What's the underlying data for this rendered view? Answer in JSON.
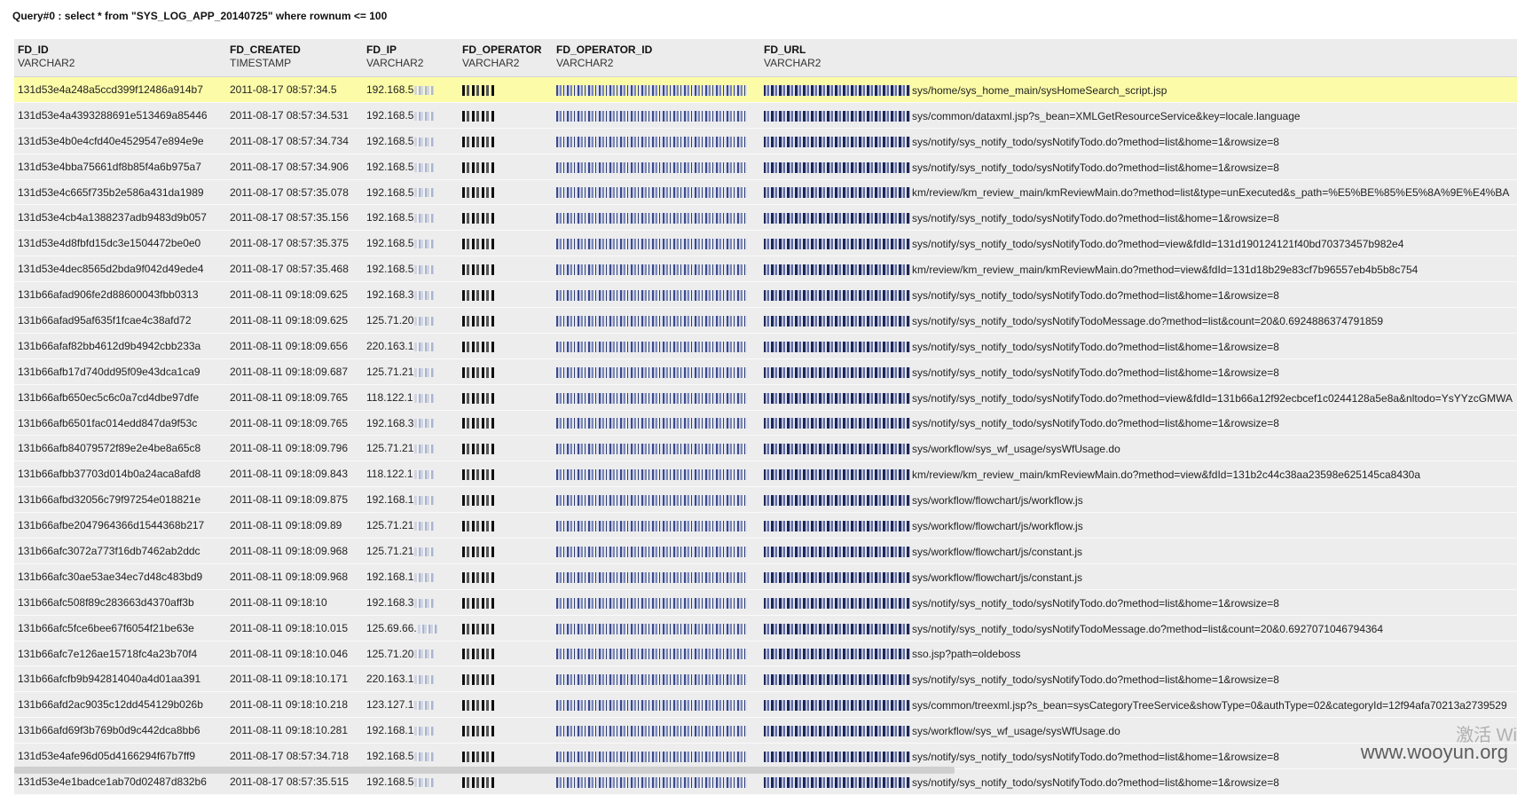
{
  "query_title": "Query#0 : select * from \"SYS_LOG_APP_20140725\" where rownum <= 100",
  "columns": [
    {
      "name": "FD_ID",
      "type": "VARCHAR2"
    },
    {
      "name": "FD_CREATED",
      "type": "TIMESTAMP"
    },
    {
      "name": "FD_IP",
      "type": "VARCHAR2"
    },
    {
      "name": "FD_OPERATOR",
      "type": "VARCHAR2"
    },
    {
      "name": "FD_OPERATOR_ID",
      "type": "VARCHAR2"
    },
    {
      "name": "FD_URL",
      "type": "VARCHAR2"
    }
  ],
  "rows": [
    {
      "id": "131d53e4a248a5ccd399f12486a914b7",
      "created": "2011-08-17 08:57:34.5",
      "ip": "192.168.5",
      "url": "sys/home/sys_home_main/sysHomeSearch_script.jsp"
    },
    {
      "id": "131d53e4a4393288691e513469a85446",
      "created": "2011-08-17 08:57:34.531",
      "ip": "192.168.5",
      "url": "sys/common/dataxml.jsp?s_bean=XMLGetResourceService&key=locale.language"
    },
    {
      "id": "131d53e4b0e4cfd40e4529547e894e9e",
      "created": "2011-08-17 08:57:34.734",
      "ip": "192.168.5",
      "url": "sys/notify/sys_notify_todo/sysNotifyTodo.do?method=list&home=1&rowsize=8"
    },
    {
      "id": "131d53e4bba75661df8b85f4a6b975a7",
      "created": "2011-08-17 08:57:34.906",
      "ip": "192.168.5",
      "url": "sys/notify/sys_notify_todo/sysNotifyTodo.do?method=list&home=1&rowsize=8"
    },
    {
      "id": "131d53e4c665f735b2e586a431da1989",
      "created": "2011-08-17 08:57:35.078",
      "ip": "192.168.5",
      "url": "km/review/km_review_main/kmReviewMain.do?method=list&type=unExecuted&s_path=%E5%BE%85%E5%8A%9E%E4%BA"
    },
    {
      "id": "131d53e4cb4a1388237adb9483d9b057",
      "created": "2011-08-17 08:57:35.156",
      "ip": "192.168.5",
      "url": "sys/notify/sys_notify_todo/sysNotifyTodo.do?method=list&home=1&rowsize=8"
    },
    {
      "id": "131d53e4d8fbfd15dc3e1504472be0e0",
      "created": "2011-08-17 08:57:35.375",
      "ip": "192.168.5",
      "url": "sys/notify/sys_notify_todo/sysNotifyTodo.do?method=view&fdId=131d190124121f40bd70373457b982e4"
    },
    {
      "id": "131d53e4dec8565d2bda9f042d49ede4",
      "created": "2011-08-17 08:57:35.468",
      "ip": "192.168.5",
      "url": "km/review/km_review_main/kmReviewMain.do?method=view&fdId=131d18b29e83cf7b96557eb4b5b8c754"
    },
    {
      "id": "131b66afad906fe2d88600043fbb0313",
      "created": "2011-08-11 09:18:09.625",
      "ip": "192.168.3",
      "url": "sys/notify/sys_notify_todo/sysNotifyTodo.do?method=list&home=1&rowsize=8"
    },
    {
      "id": "131b66afad95af635f1fcae4c38afd72",
      "created": "2011-08-11 09:18:09.625",
      "ip": "125.71.20",
      "url": "sys/notify/sys_notify_todo/sysNotifyTodoMessage.do?method=list&count=20&0.6924886374791859"
    },
    {
      "id": "131b66afaf82bb4612d9b4942cbb233a",
      "created": "2011-08-11 09:18:09.656",
      "ip": "220.163.1",
      "url": "sys/notify/sys_notify_todo/sysNotifyTodo.do?method=list&home=1&rowsize=8"
    },
    {
      "id": "131b66afb17d740dd95f09e43dca1ca9",
      "created": "2011-08-11 09:18:09.687",
      "ip": "125.71.21",
      "url": "sys/notify/sys_notify_todo/sysNotifyTodo.do?method=list&home=1&rowsize=8"
    },
    {
      "id": "131b66afb650ec5c6c0a7cd4dbe97dfe",
      "created": "2011-08-11 09:18:09.765",
      "ip": "118.122.1",
      "url": "sys/notify/sys_notify_todo/sysNotifyTodo.do?method=view&fdId=131b66a12f92ecbcef1c0244128a5e8a&nltodo=YsYYzcGMWA"
    },
    {
      "id": "131b66afb6501fac014edd847da9f53c",
      "created": "2011-08-11 09:18:09.765",
      "ip": "192.168.3",
      "url": "sys/notify/sys_notify_todo/sysNotifyTodo.do?method=list&home=1&rowsize=8"
    },
    {
      "id": "131b66afb84079572f89e2e4be8a65c8",
      "created": "2011-08-11 09:18:09.796",
      "ip": "125.71.21",
      "url": "sys/workflow/sys_wf_usage/sysWfUsage.do"
    },
    {
      "id": "131b66afbb37703d014b0a24aca8afd8",
      "created": "2011-08-11 09:18:09.843",
      "ip": "118.122.1",
      "url": "km/review/km_review_main/kmReviewMain.do?method=view&fdId=131b2c44c38aa23598e625145ca8430a"
    },
    {
      "id": "131b66afbd32056c79f97254e018821e",
      "created": "2011-08-11 09:18:09.875",
      "ip": "192.168.1",
      "url": "sys/workflow/flowchart/js/workflow.js"
    },
    {
      "id": "131b66afbe2047964366d1544368b217",
      "created": "2011-08-11 09:18:09.89",
      "ip": "125.71.21",
      "url": "sys/workflow/flowchart/js/workflow.js"
    },
    {
      "id": "131b66afc3072a773f16db7462ab2ddc",
      "created": "2011-08-11 09:18:09.968",
      "ip": "125.71.21",
      "url": "sys/workflow/flowchart/js/constant.js"
    },
    {
      "id": "131b66afc30ae53ae34ec7d48c483bd9",
      "created": "2011-08-11 09:18:09.968",
      "ip": "192.168.1",
      "url": "sys/workflow/flowchart/js/constant.js"
    },
    {
      "id": "131b66afc508f89c283663d4370aff3b",
      "created": "2011-08-11 09:18:10",
      "ip": "192.168.3",
      "url": "sys/notify/sys_notify_todo/sysNotifyTodo.do?method=list&home=1&rowsize=8"
    },
    {
      "id": "131b66afc5fce6bee67f6054f21be63e",
      "created": "2011-08-11 09:18:10.015",
      "ip": "125.69.66.",
      "url": "sys/notify/sys_notify_todo/sysNotifyTodoMessage.do?method=list&count=20&0.6927071046794364"
    },
    {
      "id": "131b66afc7e126ae15718fc4a23b70f4",
      "created": "2011-08-11 09:18:10.046",
      "ip": "125.71.20",
      "url": "sso.jsp?path=oldeboss"
    },
    {
      "id": "131b66afcfb9b942814040a4d01aa391",
      "created": "2011-08-11 09:18:10.171",
      "ip": "220.163.1",
      "url": "sys/notify/sys_notify_todo/sysNotifyTodo.do?method=list&home=1&rowsize=8"
    },
    {
      "id": "131b66afd2ac9035c12dd454129b026b",
      "created": "2011-08-11 09:18:10.218",
      "ip": "123.127.1",
      "url": "sys/common/treexml.jsp?s_bean=sysCategoryTreeService&showType=0&authType=02&categoryId=12f94afa70213a2739529"
    },
    {
      "id": "131b66afd69f3b769b0d9c442dca8bb6",
      "created": "2011-08-11 09:18:10.281",
      "ip": "192.168.1",
      "url": "sys/workflow/sys_wf_usage/sysWfUsage.do"
    },
    {
      "id": "131d53e4afe96d05d4166294f67b7ff9",
      "created": "2011-08-17 08:57:34.718",
      "ip": "192.168.5",
      "url": "sys/notify/sys_notify_todo/sysNotifyTodo.do?method=list&home=1&rowsize=8"
    },
    {
      "id": "131d53e4e1badce1ab70d02487d832b6",
      "created": "2011-08-17 08:57:35.515",
      "ip": "192.168.5",
      "url": "sys/notify/sys_notify_todo/sysNotifyTodo.do?method=list&home=1&rowsize=8"
    }
  ],
  "selected_row_index": 0,
  "watermark": "www.wooyun.org",
  "activate_text": "激活 Wi"
}
